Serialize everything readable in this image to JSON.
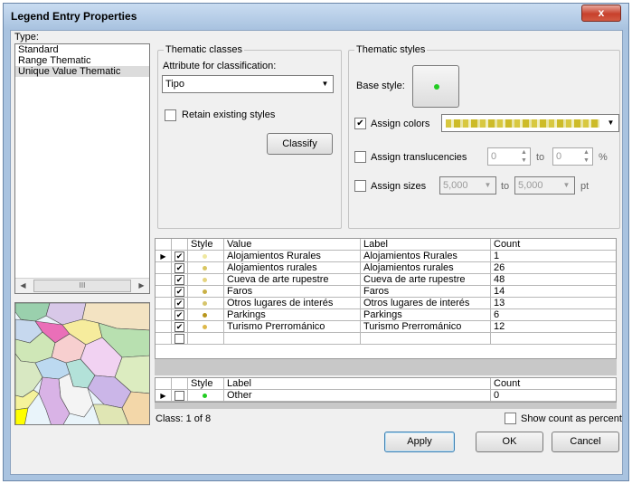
{
  "window": {
    "title": "Legend Entry Properties",
    "close_label": "x"
  },
  "type_panel": {
    "label": "Type:",
    "items": [
      "Standard",
      "Range Thematic",
      "Unique Value Thematic"
    ],
    "scroll_thumb": "III"
  },
  "thematic_classes": {
    "title": "Thematic classes",
    "attribute_label": "Attribute for classification:",
    "attribute_value": "Tipo",
    "retain_label": "Retain existing styles",
    "retain_checked": false,
    "classify_label": "Classify"
  },
  "thematic_styles": {
    "title": "Thematic styles",
    "base_style_label": "Base style:",
    "assign_colors_label": "Assign colors",
    "assign_colors_checked": true,
    "assign_translucencies_label": "Assign translucencies",
    "translucency_from": "0",
    "translucency_to": "0",
    "to_label": "to",
    "percent_label": "%",
    "assign_sizes_label": "Assign sizes",
    "size_from": "5,000",
    "size_to": "5,000",
    "pt_label": "pt",
    "gradient_colors": [
      "#d8c840",
      "#e6e8a8",
      "#cdbb28",
      "#ece9b0",
      "#c8b420"
    ]
  },
  "classes_table": {
    "headers": [
      "Style",
      "Value",
      "Label",
      "Count"
    ],
    "rows": [
      {
        "value": "Alojamientos Rurales",
        "label": "Alojamientos Rurales",
        "count": "1",
        "color": "#efe8a0",
        "checked": true,
        "current": true
      },
      {
        "value": "Alojamientos rurales",
        "label": "Alojamientos rurales",
        "count": "26",
        "color": "#d9c661",
        "checked": true,
        "current": false
      },
      {
        "value": "Cueva de arte rupestre",
        "label": "Cueva de arte rupestre",
        "count": "48",
        "color": "#e5d480",
        "checked": true,
        "current": false
      },
      {
        "value": "Faros",
        "label": "Faros",
        "count": "14",
        "color": "#c9b045",
        "checked": true,
        "current": false
      },
      {
        "value": "Otros lugares de interés",
        "label": "Otros lugares de interés",
        "count": "13",
        "color": "#d6c46c",
        "checked": true,
        "current": false
      },
      {
        "value": "Parkings",
        "label": "Parkings",
        "count": "6",
        "color": "#b8961c",
        "checked": true,
        "current": false
      },
      {
        "value": "Turismo Prerrománico",
        "label": "Turismo Prerrománico",
        "count": "12",
        "color": "#ddb84a",
        "checked": true,
        "current": false
      }
    ]
  },
  "other_table": {
    "headers": [
      "Style",
      "Label",
      "Count"
    ],
    "row": {
      "label": "Other",
      "count": "0",
      "color": "#22cc22"
    }
  },
  "footer": {
    "class_status": "Class: 1 of 8",
    "show_count_label": "Show count as percent",
    "apply_label": "Apply",
    "ok_label": "OK",
    "cancel_label": "Cancel"
  },
  "colors": {
    "base_style_dot": "#22cc22",
    "title_bar": "#a9c3e0"
  }
}
